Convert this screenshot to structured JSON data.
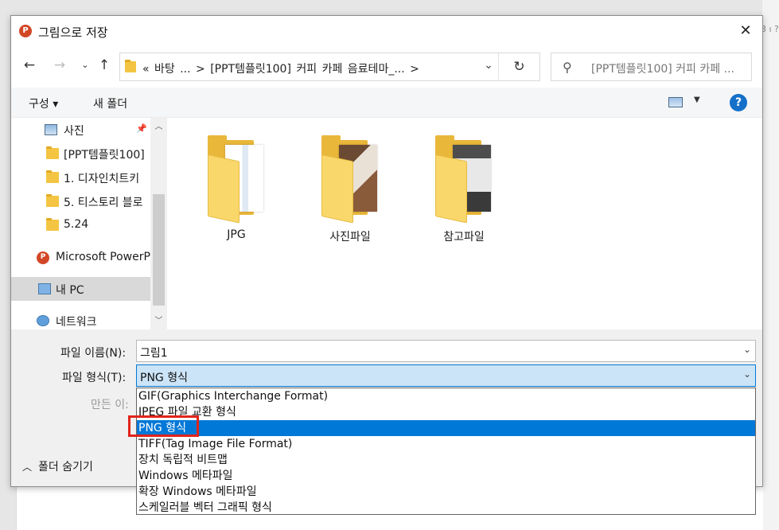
{
  "window": {
    "title": "그림으로 저장",
    "app_icon": "P"
  },
  "nav": {
    "address": "«  바탕 ...  >  [PPT템플릿100]  커피 카페 음료테마_...  >",
    "search_placeholder": "[PPT템플릿100]  커피 카페 ..."
  },
  "toolbar": {
    "organize": "구성 ▾",
    "new_folder": "새 폴더",
    "help": "?"
  },
  "sidebar": {
    "items": [
      {
        "label": "사진",
        "icon": "pictures-icon"
      },
      {
        "label": "[PPT템플릿100]",
        "icon": "folder-icon"
      },
      {
        "label": "1. 디자인치트키",
        "icon": "folder-icon"
      },
      {
        "label": "5. 티스토리 블로",
        "icon": "folder-icon"
      },
      {
        "label": "5.24",
        "icon": "folder-icon"
      },
      {
        "label": "Microsoft PowerP",
        "icon": "powerpoint-icon"
      },
      {
        "label": "내 PC",
        "icon": "pc-icon"
      },
      {
        "label": "네트워크",
        "icon": "network-icon"
      }
    ]
  },
  "files": [
    {
      "label": "JPG"
    },
    {
      "label": "사진파일"
    },
    {
      "label": "참고파일"
    }
  ],
  "form": {
    "filename_label": "파일 이름(N):",
    "filename_value": "그림1",
    "filetype_label": "파일 형식(T):",
    "filetype_value": "PNG 형식",
    "author_label": "만든 이:",
    "hide_folders": "폴더 숨기기"
  },
  "dropdown": {
    "options": [
      "GIF(Graphics Interchange Format)",
      "JPEG 파일 교환 형식",
      "PNG 형식",
      "TIFF(Tag Image File Format)",
      "장치 독립적 비트맵",
      "Windows 메타파일",
      "확장 Windows 메타파일",
      "스케일러블 벡터 그래픽 형식"
    ],
    "selected": "PNG 형식"
  },
  "colors": {
    "accent": "#0078d7",
    "highlight": "#e0241b",
    "folder": "#f4c542"
  }
}
